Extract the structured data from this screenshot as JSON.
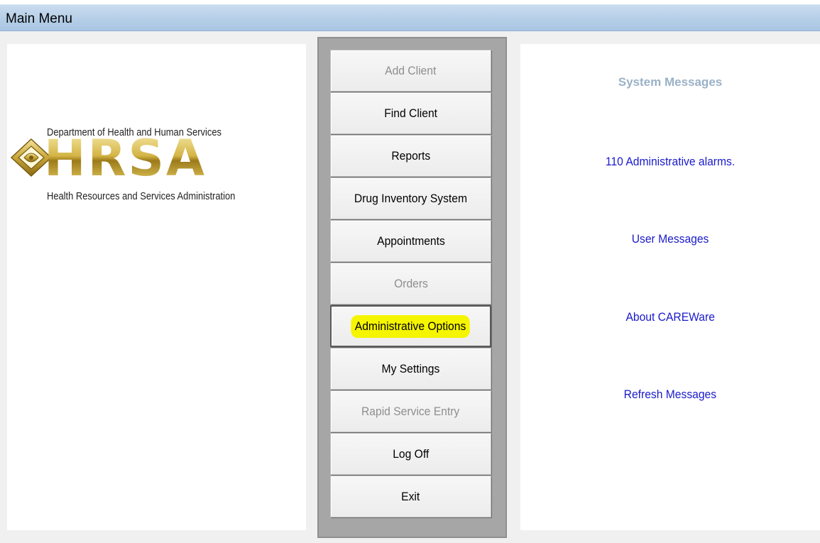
{
  "window": {
    "title": "Main Menu"
  },
  "logo": {
    "department": "Department of Health and Human Services",
    "wordmark": "HRSA",
    "full_name": "Health Resources and Services Administration"
  },
  "menu": {
    "buttons": [
      {
        "label": "Add Client",
        "enabled": false
      },
      {
        "label": "Find Client",
        "enabled": true
      },
      {
        "label": "Reports",
        "enabled": true
      },
      {
        "label": "Drug Inventory System",
        "enabled": true
      },
      {
        "label": "Appointments",
        "enabled": true
      },
      {
        "label": "Orders",
        "enabled": false
      },
      {
        "label": "Administrative Options",
        "enabled": true,
        "highlighted": true
      },
      {
        "label": "My Settings",
        "enabled": true
      },
      {
        "label": "Rapid Service Entry",
        "enabled": false
      },
      {
        "label": "Log Off",
        "enabled": true
      },
      {
        "label": "Exit",
        "enabled": true
      }
    ]
  },
  "messages": {
    "title": "System Messages",
    "links": [
      "110 Administrative alarms.",
      "User Messages",
      "About CAREWare",
      "Refresh Messages"
    ]
  },
  "colors": {
    "titlebar": "#b6cfe8",
    "highlight": "#f6f500",
    "link": "#1a1acc",
    "disabled_text": "#8e8e8e"
  }
}
